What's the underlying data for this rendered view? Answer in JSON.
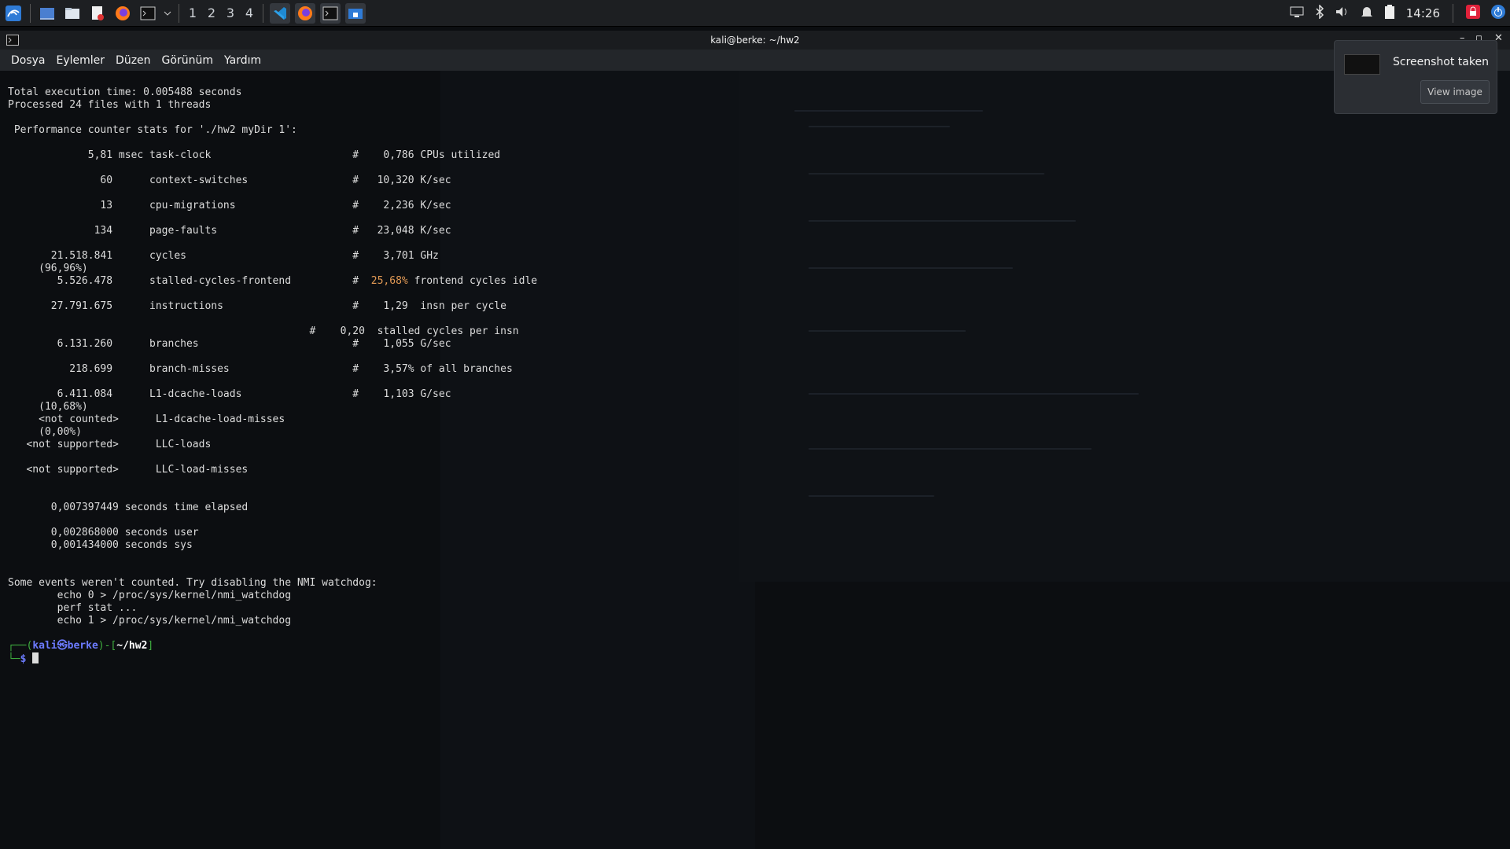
{
  "taskbar": {
    "workspaces": [
      "1",
      "2",
      "3",
      "4"
    ],
    "clock": "14:26"
  },
  "window": {
    "title": "kali@berke: ~/hw2"
  },
  "menu": [
    "Dosya",
    "Eylemler",
    "Düzen",
    "Görünüm",
    "Yardım"
  ],
  "terminal": {
    "lines": [
      "Total execution time: 0.005488 seconds",
      "Processed 24 files with 1 threads",
      " Performance counter stats for './hw2 myDir 1':",
      "             5,81 msec task-clock                       #    0,786 CPUs utilized",
      "               60      context-switches                 #   10,320 K/sec",
      "               13      cpu-migrations                   #    2,236 K/sec",
      "              134      page-faults                      #   23,048 K/sec",
      "       21.518.841      cycles                           #    3,701 GHz",
      "     (96,96%)",
      "        5.526.478      stalled-cycles-frontend          #  ",
      "       27.791.675      instructions                     #    1,29  insn per cycle",
      "                                                 #    0,20  stalled cycles per insn",
      "        6.131.260      branches                         #    1,055 G/sec",
      "          218.699      branch-misses                    #    3,57% of all branches",
      "        6.411.084      L1-dcache-loads                  #    1,103 G/sec",
      "     (10,68%)",
      "     <not counted>      L1-dcache-load-misses",
      "     (0,00%)",
      "   <not supported>      LLC-loads",
      "   <not supported>      LLC-load-misses",
      "       0,007397449 seconds time elapsed",
      "       0,002868000 seconds user",
      "       0,001434000 seconds sys",
      "Some events weren't counted. Try disabling the NMI watchdog:",
      "        echo 0 > /proc/sys/kernel/nmi_watchdog",
      "        perf stat ...",
      "        echo 1 > /proc/sys/kernel/nmi_watchdog"
    ],
    "frontend_highlight": "25,68%",
    "frontend_suffix": " frontend cycles idle",
    "prompt": {
      "open": "┌──(",
      "user": "kali",
      "at": "㉿",
      "host": "berke",
      "mid": ")-[",
      "path": "~/hw2",
      "close": "]",
      "line2": "└─",
      "dollar": "$ "
    }
  },
  "notification": {
    "title": "Screenshot taken",
    "button": "View image"
  }
}
